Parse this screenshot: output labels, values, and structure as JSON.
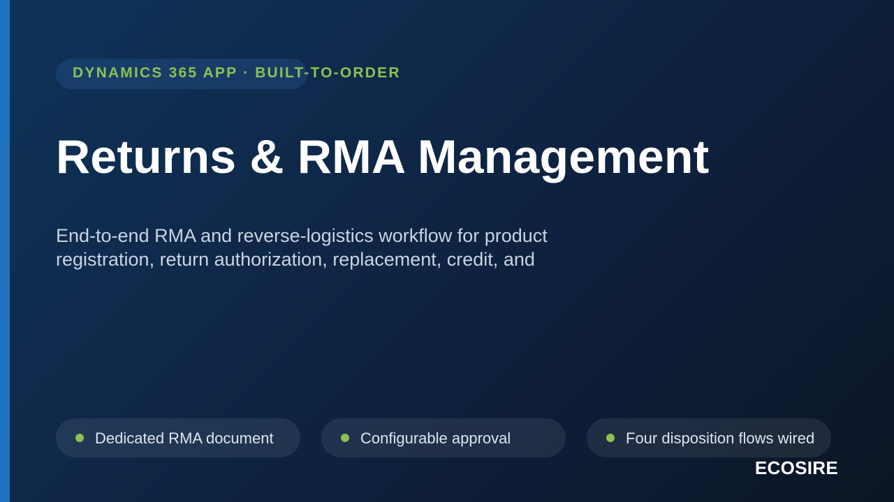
{
  "tag": {
    "text": "DYNAMICS 365 APP · BUILT-TO-ORDER"
  },
  "title": "Returns & RMA Management",
  "description": {
    "lines": [
      "End-to-end RMA and reverse-logistics workflow for product",
      "registration, return authorization, replacement, credit, and"
    ]
  },
  "features": [
    {
      "label": "Dedicated RMA document"
    },
    {
      "label": "Configurable approval"
    },
    {
      "label": "Four disposition flows wired"
    }
  ],
  "brand": "ECOSIRE",
  "colors": {
    "accent_bar": "#1f73c0",
    "tag_green": "#8cc152",
    "background_start": "#0e3358",
    "background_end": "#0b1524"
  }
}
